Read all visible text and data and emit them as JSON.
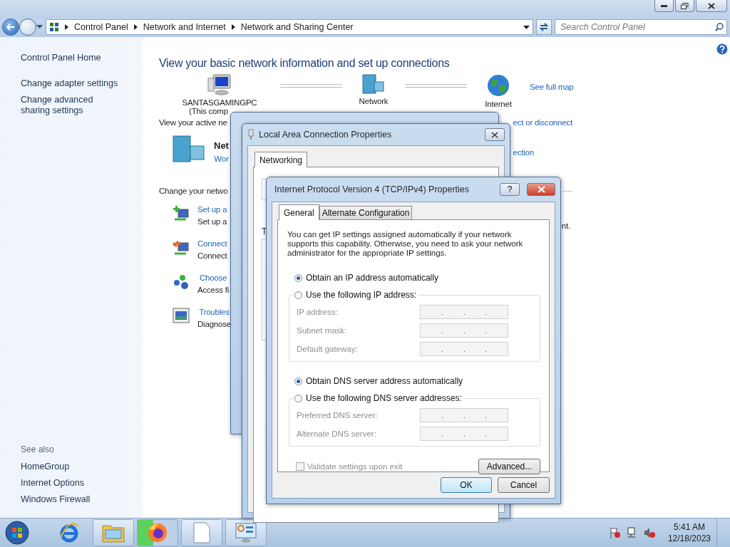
{
  "window": {
    "breadcrumb": [
      "Control Panel",
      "Network and Internet",
      "Network and Sharing Center"
    ],
    "search": {
      "placeholder": "Search Control Panel"
    }
  },
  "sidebar": {
    "items": [
      "Control Panel Home",
      "Change adapter settings",
      "Change advanced sharing settings"
    ],
    "see_also_title": "See also",
    "see_also": [
      "HomeGroup",
      "Internet Options",
      "Windows Firewall"
    ]
  },
  "content": {
    "title": "View your basic network information and set up connections",
    "map": [
      {
        "kind": "computer",
        "label": "SANTASGAMINGPC",
        "sublabel": "(This comp"
      },
      {
        "kind": "network",
        "label": "Network"
      },
      {
        "kind": "internet",
        "label": "Internet"
      }
    ],
    "see_full_map": "See full map",
    "active_label": "View your active ne",
    "connect_link": "ect or disconnect",
    "network_name": "Net",
    "network_type": "Wor",
    "connection_link": "ection",
    "change_label": "Change your netwo",
    "tasks": [
      {
        "kind": "new-connection",
        "title": "Set up a",
        "desc": "Set up a"
      },
      {
        "kind": "connect",
        "title": "Connect",
        "desc": "Connect"
      },
      {
        "kind": "homegroup",
        "title": "Choose",
        "desc": "Access fi"
      },
      {
        "kind": "troubleshoot",
        "title": "Troubles",
        "desc": "Diagnose"
      }
    ],
    "task_tail": "nt."
  },
  "dialogs": {
    "properties": {
      "title": "Local Area Connection Properties",
      "tabs": [
        {
          "label": "Networking",
          "selected": true
        }
      ],
      "list_label": "T"
    },
    "ipv4": {
      "title": "Internet Protocol Version 4 (TCP/IPv4) Properties",
      "help": "?",
      "tabs": [
        {
          "label": "General",
          "selected": true
        },
        {
          "label": "Alternate Configuration",
          "selected": false
        }
      ],
      "description": "You can get IP settings assigned automatically if your network supports this capability. Otherwise, you need to ask your network administrator for the appropriate IP settings.",
      "ip_options": [
        {
          "label": "Obtain an IP address automatically",
          "selected": true
        },
        {
          "label": "Use the following IP address:",
          "selected": false
        }
      ],
      "ip_fields": [
        {
          "label": "IP address:",
          "disabled": true
        },
        {
          "label": "Subnet mask:",
          "disabled": true
        },
        {
          "label": "Default gateway:",
          "disabled": true
        }
      ],
      "dns_options": [
        {
          "label": "Obtain DNS server address automatically",
          "selected": true
        },
        {
          "label": "Use the following DNS server addresses:",
          "selected": false
        }
      ],
      "dns_fields": [
        {
          "label": "Preferred DNS server:",
          "disabled": true
        },
        {
          "label": "Alternate DNS server:",
          "disabled": true
        }
      ],
      "validate": {
        "label": "Validate settings upon exit",
        "checked": false,
        "disabled": true
      },
      "advanced": "Advanced...",
      "ok": "OK",
      "cancel": "Cancel"
    }
  },
  "taskbar": {
    "items": [
      {
        "kind": "internet-explorer"
      },
      {
        "kind": "explorer"
      },
      {
        "kind": "firefox"
      },
      {
        "kind": "notepad"
      },
      {
        "kind": "control-panel"
      }
    ],
    "tray": [
      {
        "kind": "flag"
      },
      {
        "kind": "network"
      },
      {
        "kind": "volume"
      }
    ],
    "time": "5:41 AM",
    "date": "12/18/2023"
  }
}
